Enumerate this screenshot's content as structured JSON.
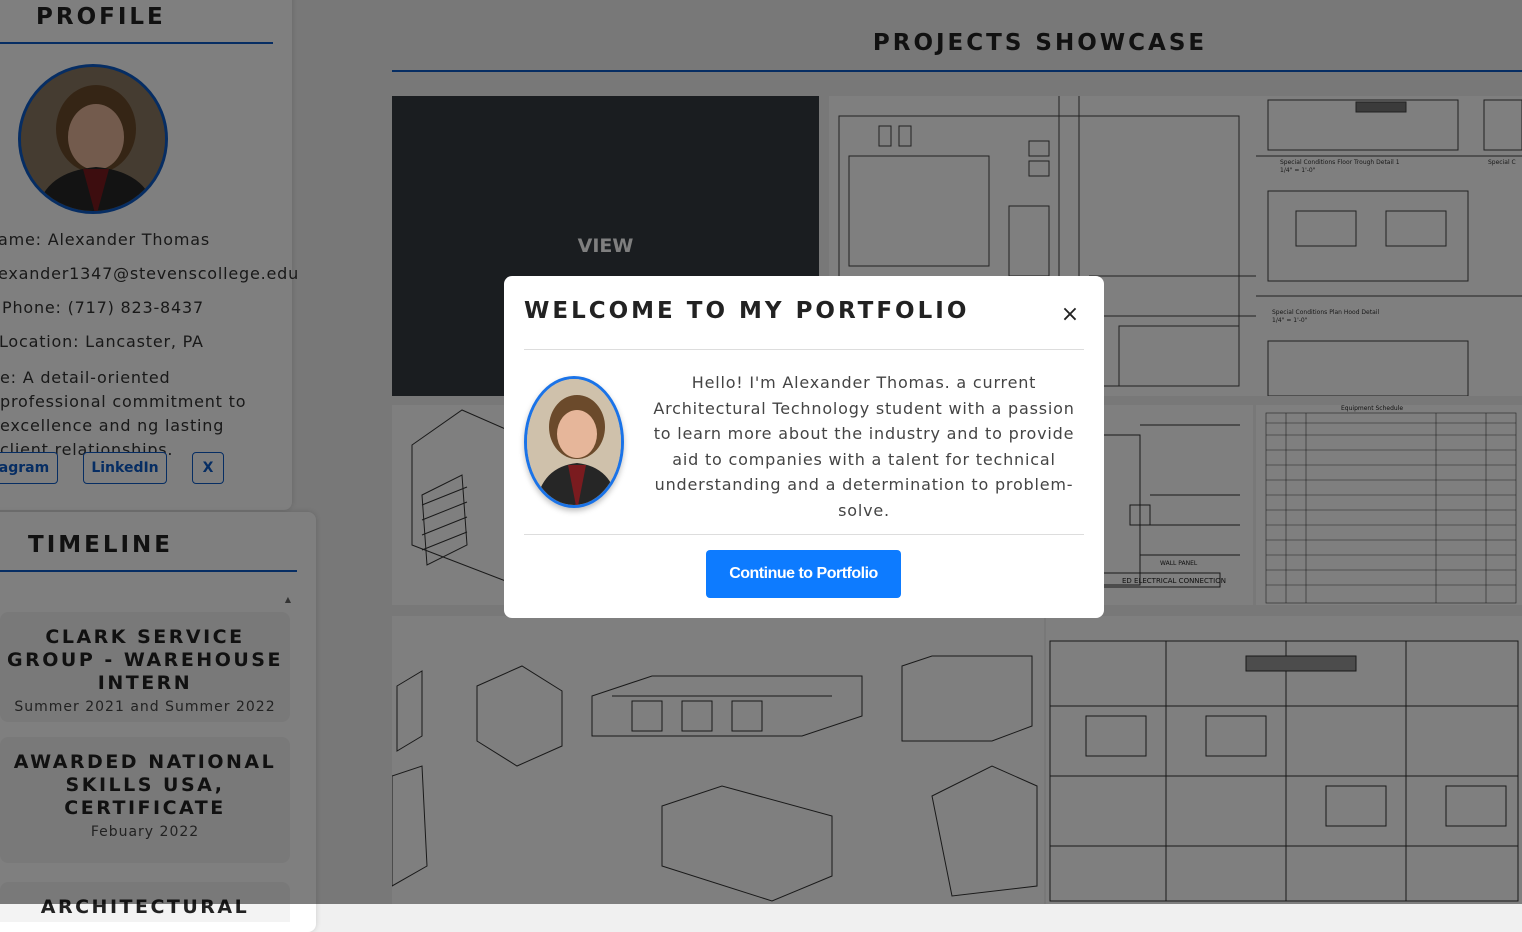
{
  "profile": {
    "title": "PROFILE",
    "avatar_alt": "profile-photo",
    "name_line": "ame: Alexander Thomas",
    "email_line": "exander1347@stevenscollege.edu",
    "phone_line": "Phone: (717) 823-8437",
    "location_line": "Location: Lancaster, PA",
    "bio": "e: A detail-oriented professional commitment to excellence and ng lasting client relationships.",
    "social": {
      "instagram": "agram",
      "linkedin": "LinkedIn",
      "x": "X"
    }
  },
  "timeline": {
    "title": "TIMELINE",
    "items": [
      {
        "title": "CLARK SERVICE GROUP - WAREHOUSE INTERN",
        "date": "Summer 2021 and Summer 2022"
      },
      {
        "title": "AWARDED NATIONAL SKILLS USA, CERTIFICATE",
        "date": "Febuary 2022"
      },
      {
        "title": "ARCHITECTURAL",
        "date": ""
      }
    ]
  },
  "showcase": {
    "title": "PROJECTS SHOWCASE",
    "view_label": "VIEW",
    "drawing_labels": {
      "detail_1": "Special Conditions Floor Trough Detail 1",
      "detail_1_scale": "1/4\" = 1'-0\"",
      "detail_2": "Special Conditions Plan Hood Detail",
      "detail_2_scale": "1/4\" = 1'-0\"",
      "detail_3": "Special C",
      "equipment_schedule": "Equipment Schedule",
      "electrical": "ED ELECTRICAL CONNECTION",
      "wall_panel": "WALL PANEL"
    }
  },
  "modal": {
    "title": "WELCOME TO MY PORTFOLIO",
    "close": "×",
    "message": "Hello! I'm Alexander Thomas. a current Architectural Technology student with a passion to learn more about the industry and to provide aid to companies with a talent for technical understanding and a determination to problem-solve.",
    "button": "Continue to Portfolio"
  },
  "colors": {
    "accent": "#0d5bc6",
    "button": "#0d7bff",
    "backdrop": "rgba(0,0,0,0.5)"
  }
}
